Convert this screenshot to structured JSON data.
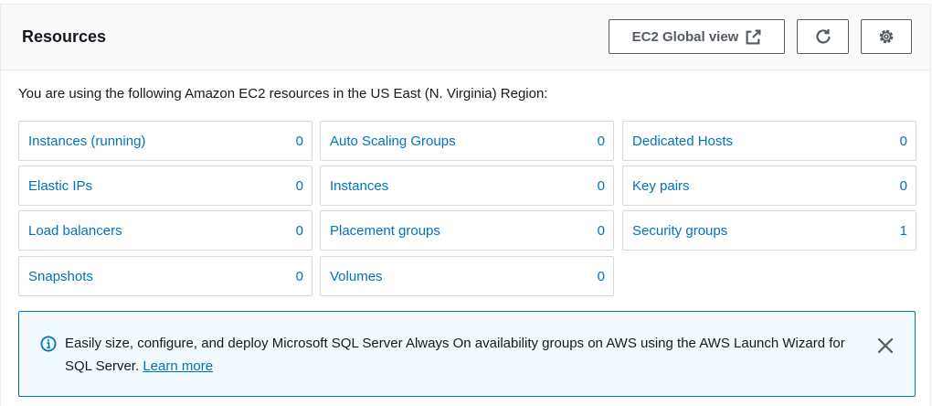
{
  "header": {
    "title": "Resources",
    "global_view_label": "EC2 Global view"
  },
  "description": "You are using the following Amazon EC2 resources in the US East (N. Virginia) Region:",
  "resources": [
    {
      "label": "Instances (running)",
      "count": "0"
    },
    {
      "label": "Auto Scaling Groups",
      "count": "0"
    },
    {
      "label": "Dedicated Hosts",
      "count": "0"
    },
    {
      "label": "Elastic IPs",
      "count": "0"
    },
    {
      "label": "Instances",
      "count": "0"
    },
    {
      "label": "Key pairs",
      "count": "0"
    },
    {
      "label": "Load balancers",
      "count": "0"
    },
    {
      "label": "Placement groups",
      "count": "0"
    },
    {
      "label": "Security groups",
      "count": "1"
    },
    {
      "label": "Snapshots",
      "count": "0"
    },
    {
      "label": "Volumes",
      "count": "0"
    }
  ],
  "alert": {
    "text": "Easily size, configure, and deploy Microsoft SQL Server Always On availability groups on AWS using the AWS Launch Wizard for SQL Server.",
    "link_label": "Learn more"
  },
  "colors": {
    "link": "#0073bb",
    "alert_background": "#f1faff",
    "alert_border": "#0073bb",
    "border": "#d5dbdb"
  },
  "icons": {
    "external_link": "external-link-icon",
    "refresh": "refresh-icon",
    "settings": "gear-icon",
    "info": "info-icon",
    "close": "close-icon"
  }
}
